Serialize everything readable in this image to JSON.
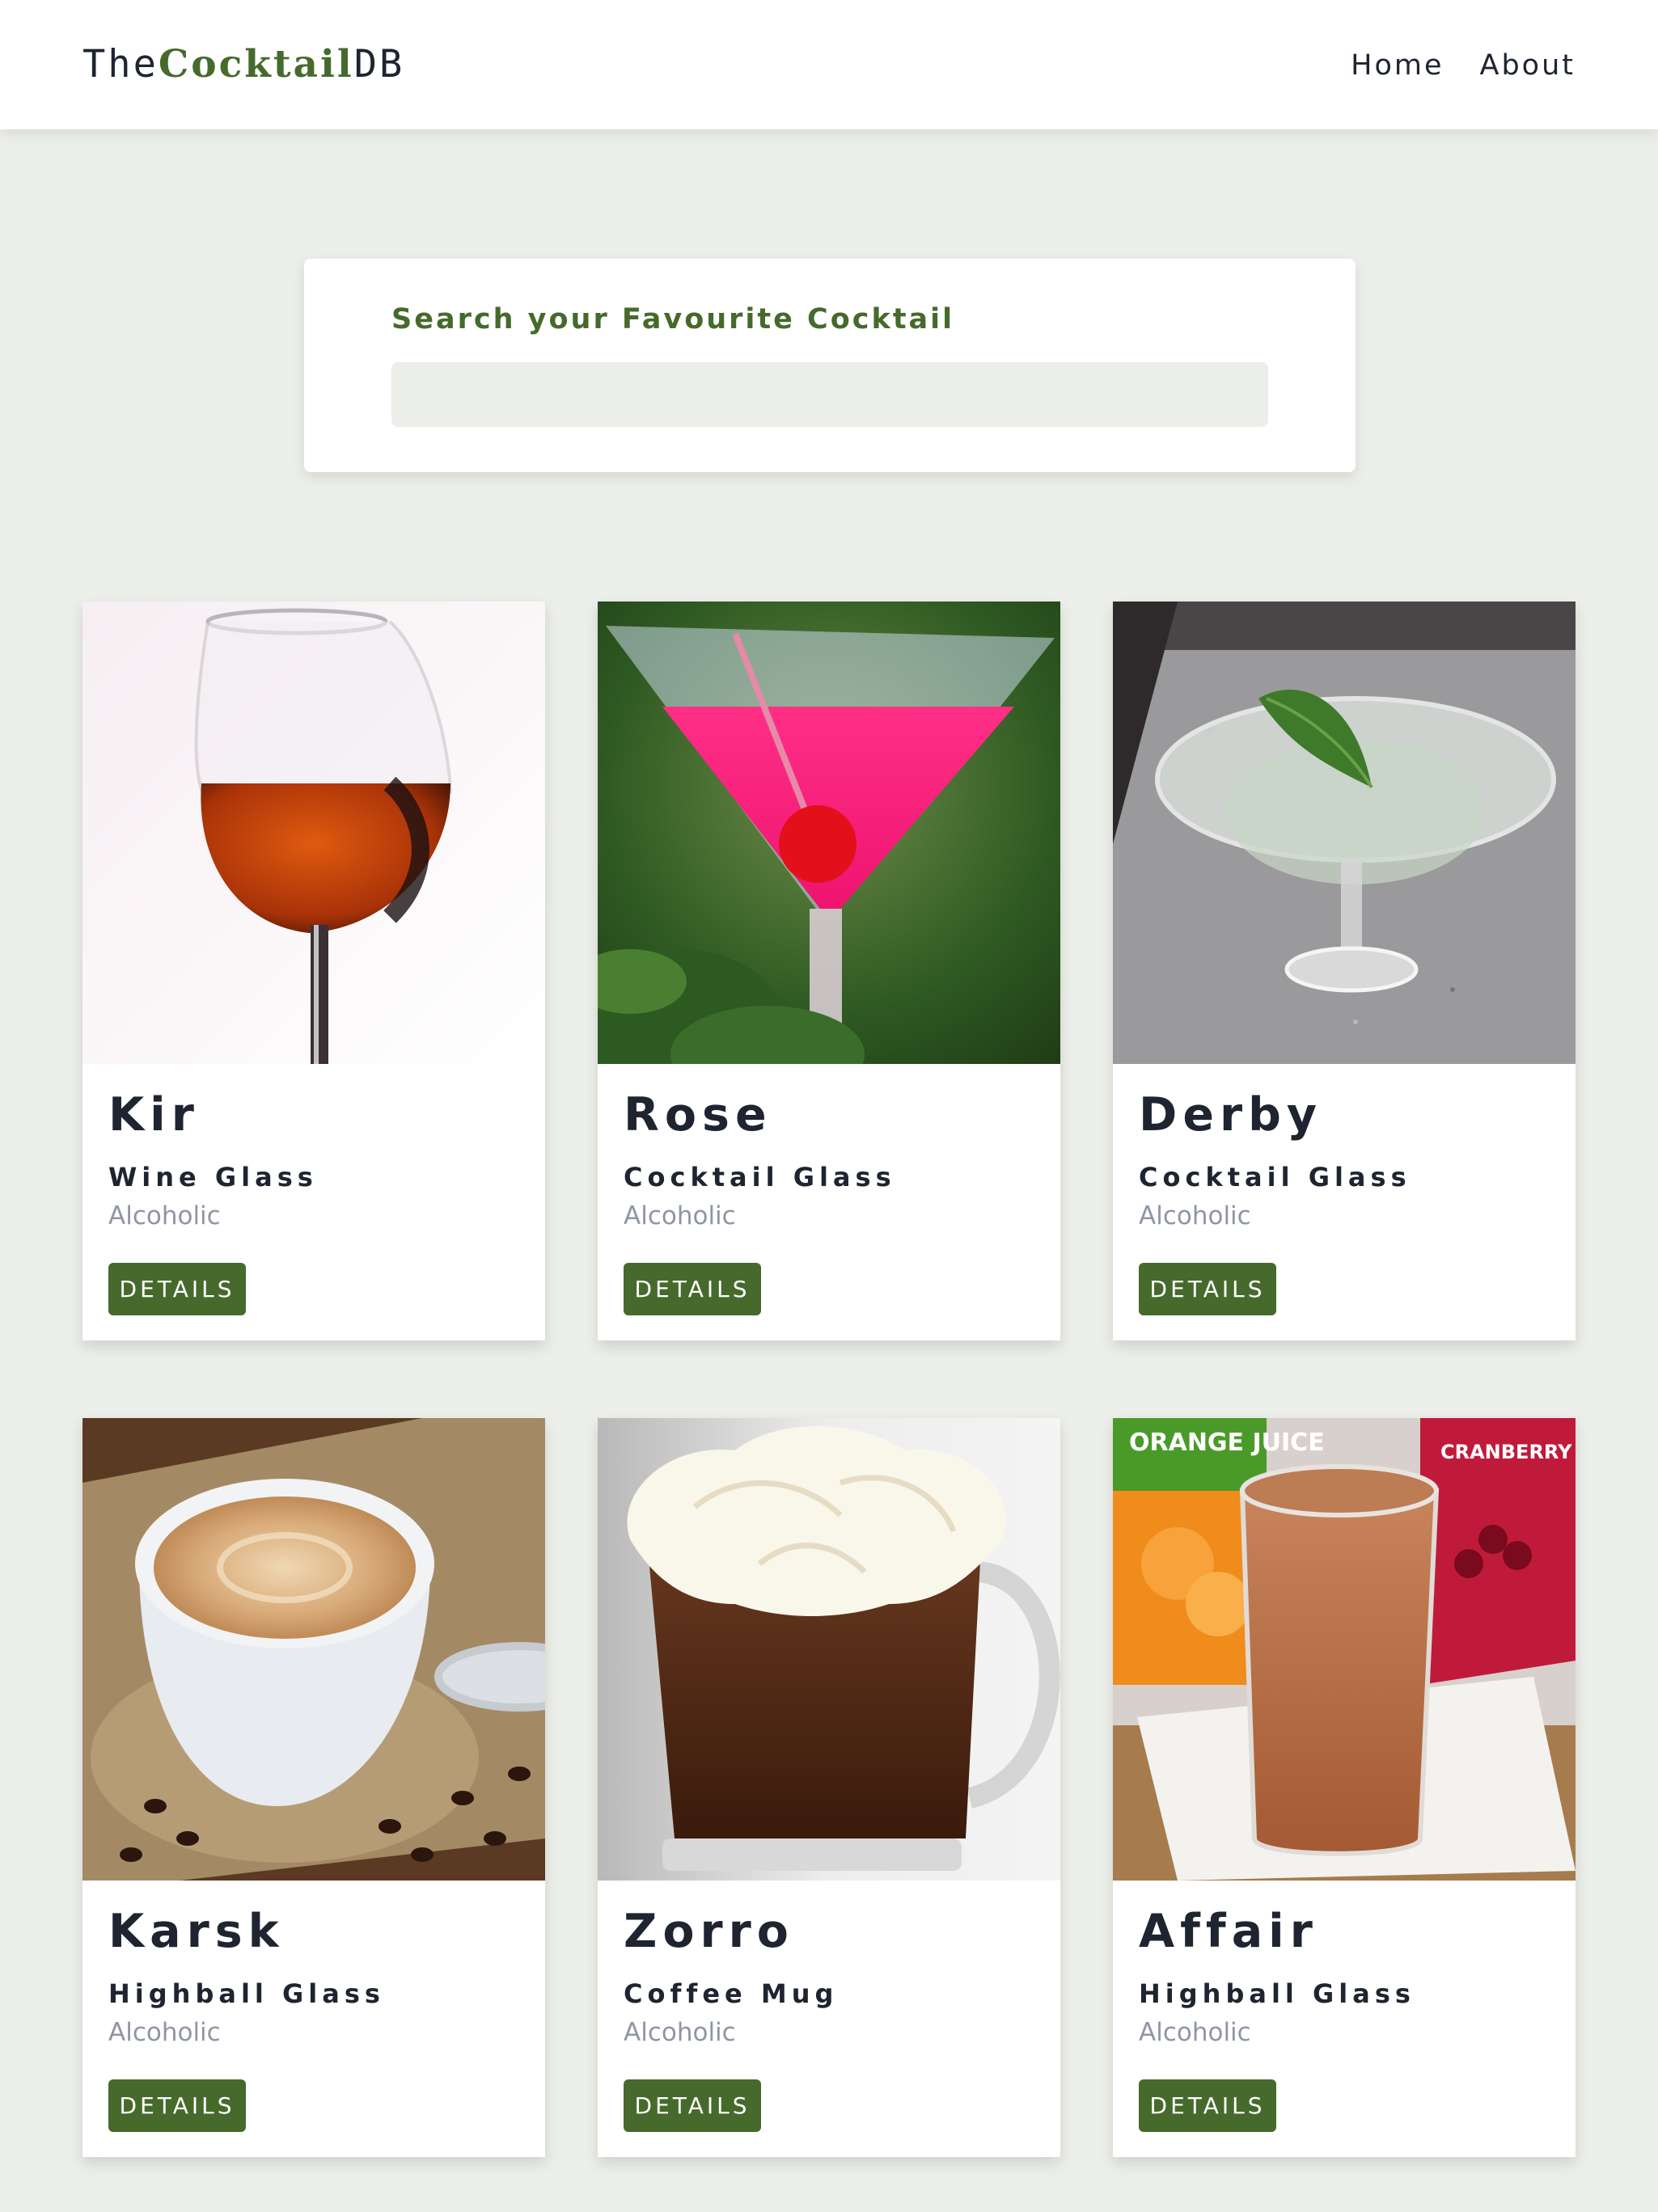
{
  "header": {
    "logo_prefix": "The",
    "logo_mid": "Cocktail",
    "logo_suffix": "DB",
    "nav": [
      {
        "label": "Home"
      },
      {
        "label": "About"
      }
    ]
  },
  "search": {
    "label": "Search your Favourite Cocktail",
    "value": "",
    "placeholder": ""
  },
  "cocktails": [
    {
      "name": "Kir",
      "glass": "Wine Glass",
      "type": "Alcoholic",
      "button": "DETAILS"
    },
    {
      "name": "Rose",
      "glass": "Cocktail Glass",
      "type": "Alcoholic",
      "button": "DETAILS"
    },
    {
      "name": "Derby",
      "glass": "Cocktail Glass",
      "type": "Alcoholic",
      "button": "DETAILS"
    },
    {
      "name": "Karsk",
      "glass": "Highball Glass",
      "type": "Alcoholic",
      "button": "DETAILS"
    },
    {
      "name": "Zorro",
      "glass": "Coffee Mug",
      "type": "Alcoholic",
      "button": "DETAILS"
    },
    {
      "name": "Affair",
      "glass": "Highball Glass",
      "type": "Alcoholic",
      "button": "DETAILS"
    }
  ],
  "image_text": {
    "orange_juice": "ORANGE JUICE",
    "cranberry": "CRANBERRY JUICE DRINK"
  },
  "colors": {
    "accent": "#466a2c",
    "background": "#eceee9",
    "text": "#1e2430",
    "muted": "#8f96a3"
  }
}
